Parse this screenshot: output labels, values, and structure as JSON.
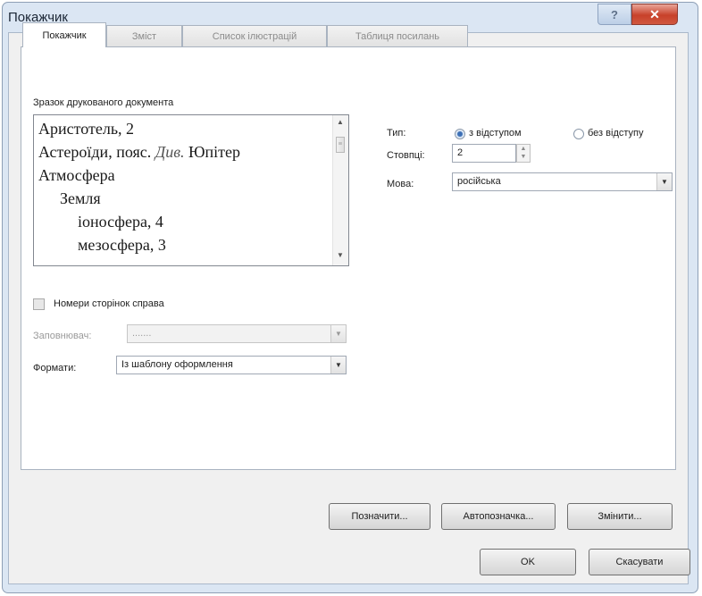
{
  "window": {
    "title": "Покажчик",
    "help_glyph": "?",
    "close_glyph": "✕"
  },
  "tabs": [
    {
      "label": "Покажчик",
      "active": true
    },
    {
      "label": "Зміст",
      "active": false
    },
    {
      "label": "Список ілюстрацій",
      "active": false
    },
    {
      "label": "Таблиця посилань",
      "active": false
    }
  ],
  "preview": {
    "label": "Зразок друкованого документа",
    "lines": [
      {
        "text": "Аристотель, 2"
      },
      {
        "text": "Астероїди, пояс.",
        "italic": "Див.",
        "rest": " Юпітер"
      },
      {
        "text": "Атмосфера"
      },
      {
        "text": "Земля"
      },
      {
        "text": "іоносфера, 4"
      },
      {
        "text": "мезосфера, 3"
      }
    ]
  },
  "type": {
    "label": "Тип:",
    "option_indented": "з відступом",
    "option_runin": "без відступу",
    "selected": "indented"
  },
  "columns": {
    "label": "Стовпці:",
    "value": "2"
  },
  "language": {
    "label": "Мова:",
    "value": "російська"
  },
  "page_numbers": {
    "label": "Номери сторінок справа",
    "checked": false
  },
  "filler": {
    "label": "Заповнювач:",
    "value": "......."
  },
  "formats": {
    "label": "Формати:",
    "value": "Із шаблону оформлення"
  },
  "buttons": {
    "mark": "Позначити...",
    "automark": "Автопозначка...",
    "modify": "Змінити...",
    "ok": "OK",
    "cancel": "Скасувати"
  },
  "colors": {
    "frame": "#dbe6f3",
    "close": "#c8412a",
    "radio_selected": "#3c6fb5"
  }
}
